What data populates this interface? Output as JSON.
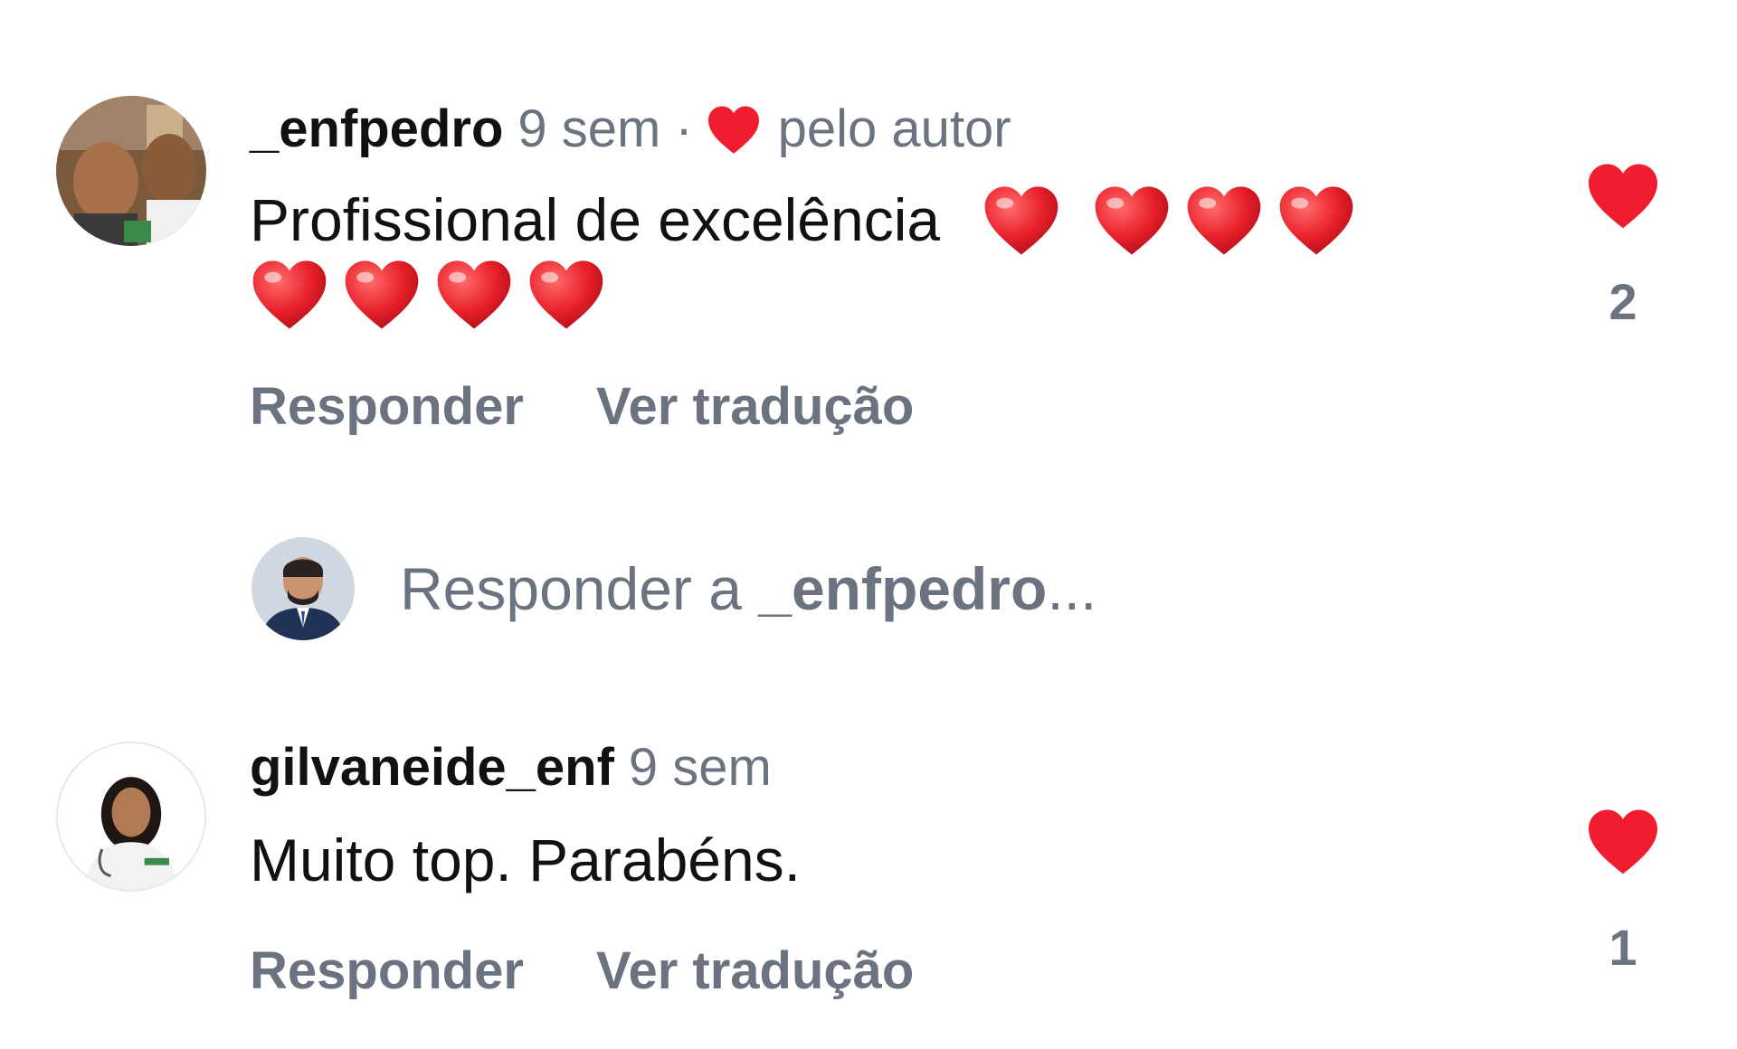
{
  "comments": [
    {
      "username": "_enfpedro",
      "time": "9 sem",
      "separator": "·",
      "liked_by_author_label": "pelo autor",
      "text": "Profissional de excelência",
      "emoji": "❤️",
      "emoji_count": 8,
      "like_count": "2",
      "reply_label": "Responder",
      "translate_label": "Ver tradução"
    },
    {
      "username": "gilvaneide_enf",
      "time": "9 sem",
      "text": "Muito top. Parabéns.",
      "like_count": "1",
      "reply_label": "Responder",
      "translate_label": "Ver tradução"
    }
  ],
  "reply_box": {
    "prefix": "Responder a ",
    "target": "_enfpedro",
    "suffix": "..."
  },
  "colors": {
    "heart": "#ef1d2f",
    "muted": "#6b7280",
    "text": "#111111"
  },
  "icons": {
    "author_heart": "heart-filled-icon",
    "like": "heart-filled-icon"
  }
}
